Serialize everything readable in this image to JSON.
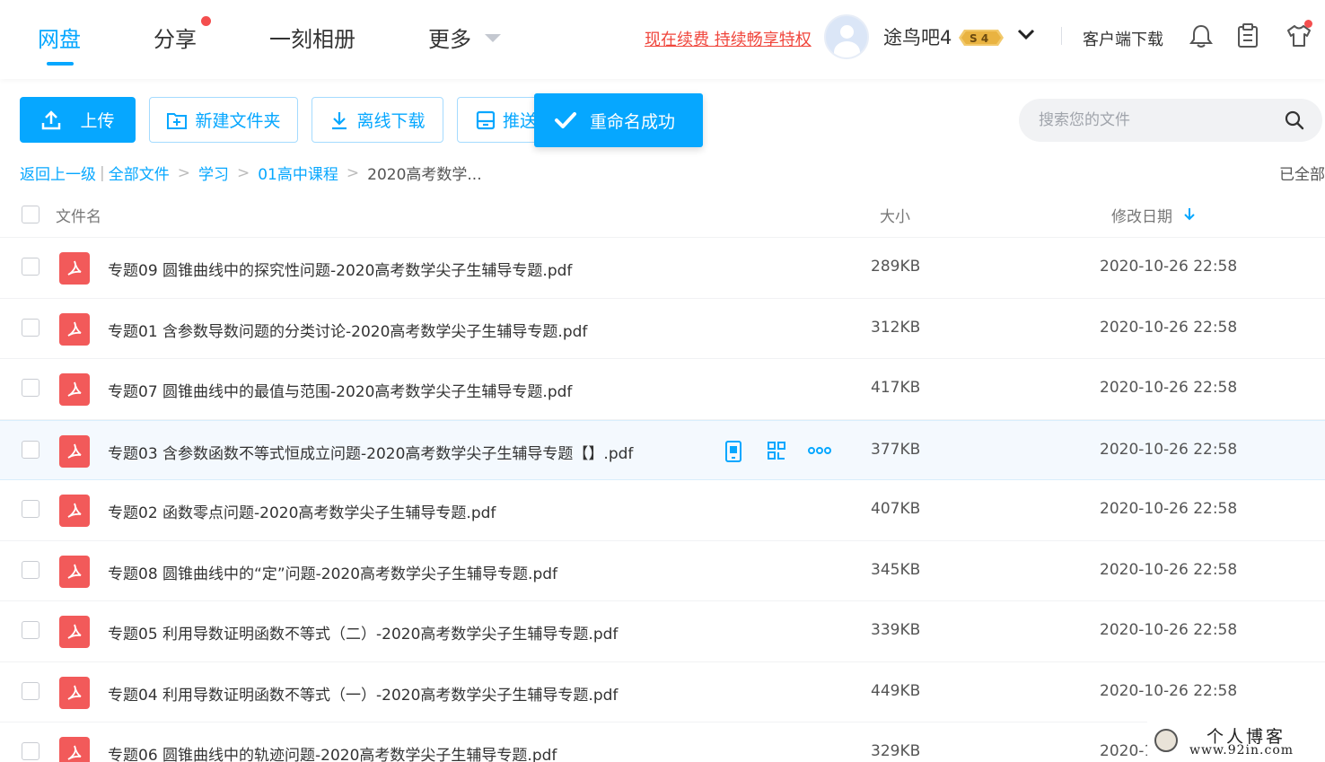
{
  "nav": {
    "tabs": [
      {
        "label": "网盘"
      },
      {
        "label": "分享"
      },
      {
        "label": "一刻相册"
      },
      {
        "label": "更多"
      }
    ],
    "promo": "现在续费 持续畅享特权",
    "username": "途鸟吧4",
    "vip_badge": "S 4",
    "client_download": "客户端下载",
    "icons": [
      "bell-icon",
      "clipboard-icon",
      "shirt-icon"
    ]
  },
  "toolbar": {
    "upload": "上传",
    "new_folder": "新建文件夹",
    "offline_download": "离线下载",
    "push": "推送",
    "toast": "重命名成功",
    "search_placeholder": "搜索您的文件"
  },
  "breadcrumb": {
    "back": "返回上一级",
    "items": [
      "全部文件",
      "学习",
      "01高中课程"
    ],
    "current": "2020高考数学...",
    "loaded": "已全部"
  },
  "table": {
    "headers": {
      "name": "文件名",
      "size": "大小",
      "date": "修改日期"
    },
    "rows": [
      {
        "name": "专题09 圆锥曲线中的探究性问题-2020高考数学尖子生辅导专题.pdf",
        "size": "289KB",
        "date": "2020-10-26 22:58"
      },
      {
        "name": "专题01 含参数导数问题的分类讨论-2020高考数学尖子生辅导专题.pdf",
        "size": "312KB",
        "date": "2020-10-26 22:58"
      },
      {
        "name": "专题07 圆锥曲线中的最值与范围-2020高考数学尖子生辅导专题.pdf",
        "size": "417KB",
        "date": "2020-10-26 22:58"
      },
      {
        "name": "专题03 含参数函数不等式恒成立问题-2020高考数学尖子生辅导专题【】.pdf",
        "size": "377KB",
        "date": "2020-10-26 22:58"
      },
      {
        "name": "专题02 函数零点问题-2020高考数学尖子生辅导专题.pdf",
        "size": "407KB",
        "date": "2020-10-26 22:58"
      },
      {
        "name": "专题08 圆锥曲线中的“定”问题-2020高考数学尖子生辅导专题.pdf",
        "size": "345KB",
        "date": "2020-10-26 22:58"
      },
      {
        "name": "专题05 利用导数证明函数不等式（二）-2020高考数学尖子生辅导专题.pdf",
        "size": "339KB",
        "date": "2020-10-26 22:58"
      },
      {
        "name": "专题04 利用导数证明函数不等式（一）-2020高考数学尖子生辅导专题.pdf",
        "size": "449KB",
        "date": "2020-10-26 22:58"
      },
      {
        "name": "专题06 圆锥曲线中的轨迹问题-2020高考数学尖子生辅导专题.pdf",
        "size": "329KB",
        "date": "2020-1"
      }
    ]
  },
  "watermark": {
    "title": "个人博客",
    "url": "www.92in.com"
  },
  "colors": {
    "accent": "#06a7ff",
    "promo": "#f0463c",
    "pdf": "#f25a5a"
  }
}
